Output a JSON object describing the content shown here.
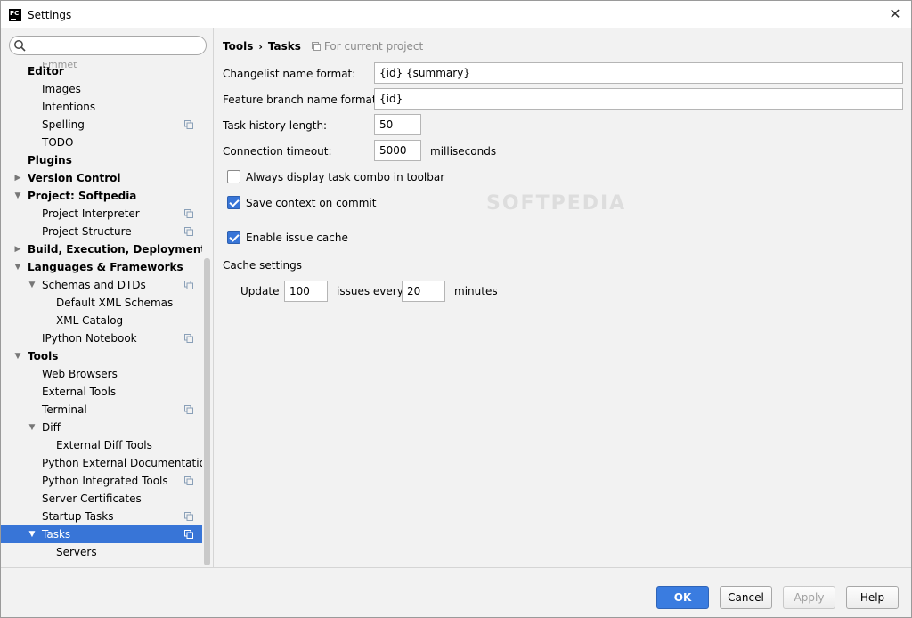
{
  "window": {
    "title": "Settings",
    "app_icon_text": "PC"
  },
  "sidebar": {
    "search": {
      "value": "",
      "placeholder": ""
    },
    "clipped_item": "Emmet",
    "items": [
      {
        "label": "Editor",
        "level": 0,
        "bold": true,
        "arrow": "",
        "scope": false
      },
      {
        "label": "Images",
        "level": 1,
        "bold": false,
        "arrow": "",
        "scope": false
      },
      {
        "label": "Intentions",
        "level": 1,
        "bold": false,
        "arrow": "",
        "scope": false
      },
      {
        "label": "Spelling",
        "level": 1,
        "bold": false,
        "arrow": "",
        "scope": true
      },
      {
        "label": "TODO",
        "level": 1,
        "bold": false,
        "arrow": "",
        "scope": false
      },
      {
        "label": "Plugins",
        "level": 0,
        "bold": true,
        "arrow": "",
        "scope": false
      },
      {
        "label": "Version Control",
        "level": 0,
        "bold": true,
        "arrow": "collapsed",
        "scope": false
      },
      {
        "label": "Project: Softpedia",
        "level": 0,
        "bold": true,
        "arrow": "expanded",
        "scope": false
      },
      {
        "label": "Project Interpreter",
        "level": 1,
        "bold": false,
        "arrow": "",
        "scope": true
      },
      {
        "label": "Project Structure",
        "level": 1,
        "bold": false,
        "arrow": "",
        "scope": true
      },
      {
        "label": "Build, Execution, Deployment",
        "level": 0,
        "bold": true,
        "arrow": "collapsed",
        "scope": false
      },
      {
        "label": "Languages & Frameworks",
        "level": 0,
        "bold": true,
        "arrow": "expanded",
        "scope": false
      },
      {
        "label": "Schemas and DTDs",
        "level": 1,
        "bold": false,
        "arrow": "expanded",
        "scope": true
      },
      {
        "label": "Default XML Schemas",
        "level": 2,
        "bold": false,
        "arrow": "",
        "scope": false
      },
      {
        "label": "XML Catalog",
        "level": 2,
        "bold": false,
        "arrow": "",
        "scope": false
      },
      {
        "label": "IPython Notebook",
        "level": 1,
        "bold": false,
        "arrow": "",
        "scope": true
      },
      {
        "label": "Tools",
        "level": 0,
        "bold": true,
        "arrow": "expanded",
        "scope": false
      },
      {
        "label": "Web Browsers",
        "level": 1,
        "bold": false,
        "arrow": "",
        "scope": false
      },
      {
        "label": "External Tools",
        "level": 1,
        "bold": false,
        "arrow": "",
        "scope": false
      },
      {
        "label": "Terminal",
        "level": 1,
        "bold": false,
        "arrow": "",
        "scope": true
      },
      {
        "label": "Diff",
        "level": 1,
        "bold": false,
        "arrow": "expanded",
        "scope": false
      },
      {
        "label": "External Diff Tools",
        "level": 2,
        "bold": false,
        "arrow": "",
        "scope": false
      },
      {
        "label": "Python External Documentation",
        "level": 1,
        "bold": false,
        "arrow": "",
        "scope": false
      },
      {
        "label": "Python Integrated Tools",
        "level": 1,
        "bold": false,
        "arrow": "",
        "scope": true
      },
      {
        "label": "Server Certificates",
        "level": 1,
        "bold": false,
        "arrow": "",
        "scope": false
      },
      {
        "label": "Startup Tasks",
        "level": 1,
        "bold": false,
        "arrow": "",
        "scope": true
      },
      {
        "label": "Tasks",
        "level": 1,
        "bold": false,
        "arrow": "expanded",
        "scope": true,
        "selected": true
      },
      {
        "label": "Servers",
        "level": 2,
        "bold": false,
        "arrow": "",
        "scope": false
      }
    ]
  },
  "breadcrumb": {
    "parent": "Tools",
    "separator": "›",
    "current": "Tasks",
    "scope_note": "For current project"
  },
  "form": {
    "changelist_label": "Changelist name format:",
    "changelist_value": "{id} {summary}",
    "feature_branch_label": "Feature branch name format:",
    "feature_branch_value": "{id}",
    "history_label": "Task history length:",
    "history_value": "50",
    "timeout_label": "Connection timeout:",
    "timeout_value": "5000",
    "timeout_unit": "milliseconds",
    "always_display_label": "Always display task combo in toolbar",
    "always_display_checked": false,
    "save_context_label": "Save context on commit",
    "save_context_checked": true,
    "enable_cache_label": "Enable issue cache",
    "enable_cache_checked": true,
    "cache_group_title": "Cache settings",
    "update_label": "Update",
    "update_value": "100",
    "issues_every_label": "issues every",
    "minutes_value": "20",
    "minutes_label": "minutes"
  },
  "watermark": "SOFTPEDIA",
  "buttons": {
    "ok": "OK",
    "cancel": "Cancel",
    "apply": "Apply",
    "help": "Help"
  },
  "colors": {
    "selection": "#3875d7",
    "primary_button": "#3a7ce0",
    "background": "#f2f2f2"
  }
}
